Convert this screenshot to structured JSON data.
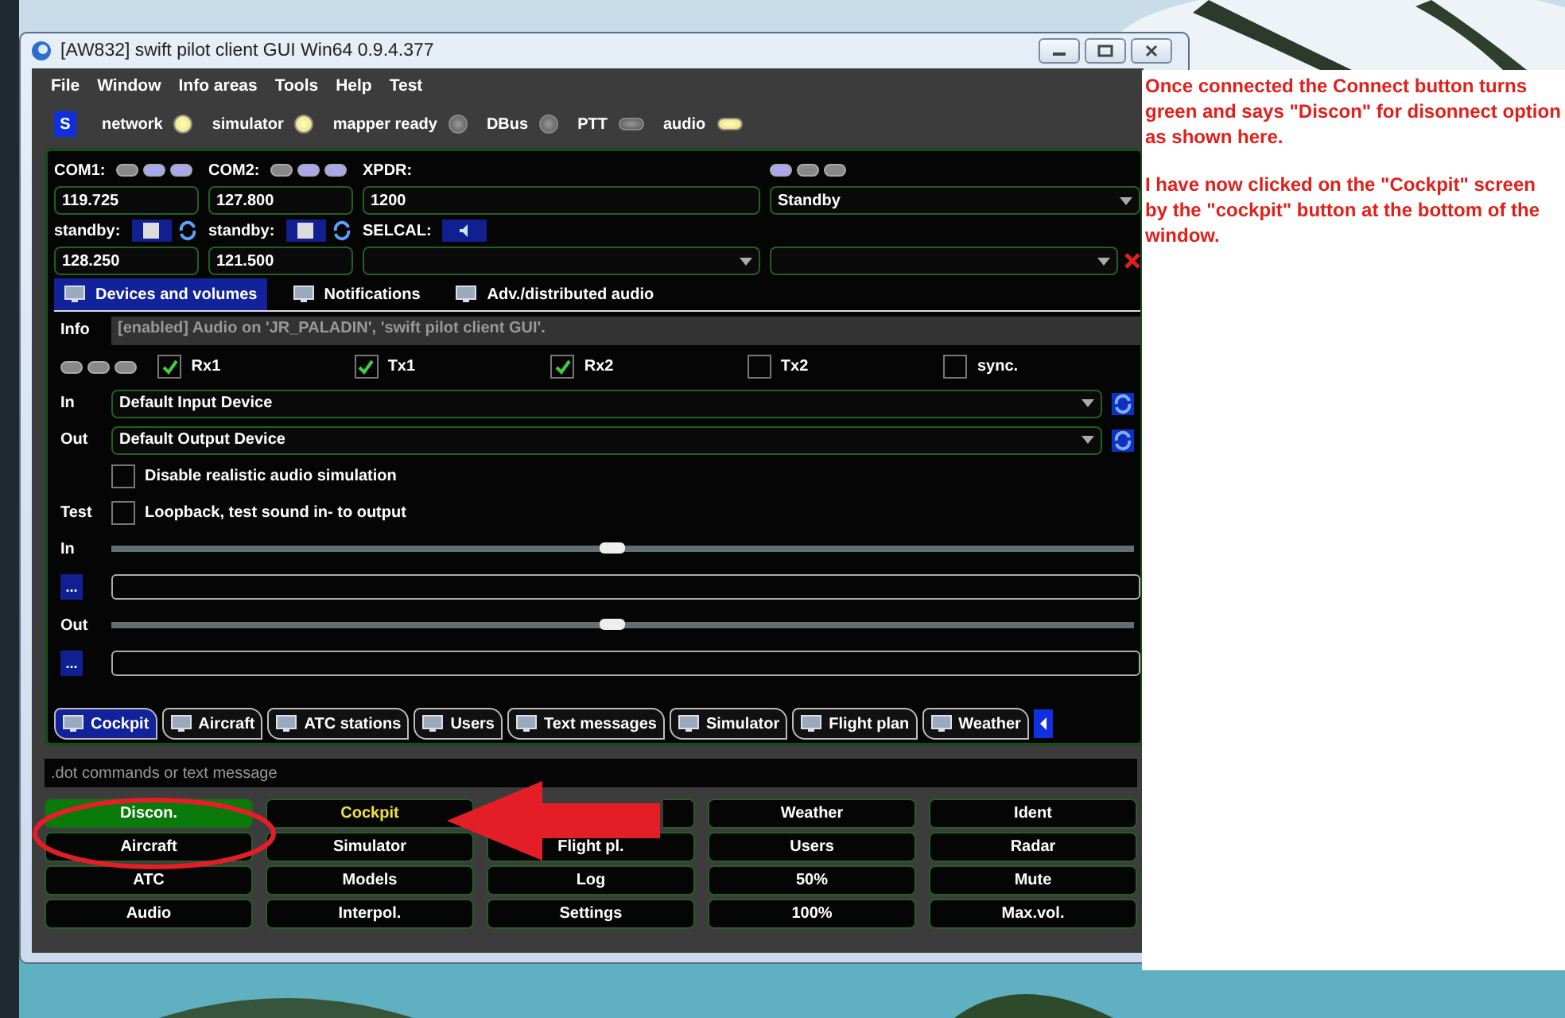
{
  "window": {
    "title": "[AW832] swift pilot client GUI Win64 0.9.4.377"
  },
  "menu": [
    "File",
    "Window",
    "Info areas",
    "Tools",
    "Help",
    "Test"
  ],
  "status": {
    "badge": "S",
    "indicators": [
      {
        "label": "network",
        "kind": "led",
        "on": true
      },
      {
        "label": "simulator",
        "kind": "led",
        "on": true
      },
      {
        "label": "mapper ready",
        "kind": "led",
        "on": false
      },
      {
        "label": "DBus",
        "kind": "led",
        "on": false
      },
      {
        "label": "PTT",
        "kind": "pill",
        "on": false
      },
      {
        "label": "audio",
        "kind": "pill",
        "on": true
      }
    ]
  },
  "radios": [
    {
      "label": "COM1:",
      "lights": [
        {
          "on": false
        },
        {
          "on": true
        },
        {
          "on": true
        }
      ],
      "active": "119.725",
      "standby_label": "standby:",
      "standby": "128.250"
    },
    {
      "label": "COM2:",
      "lights": [
        {
          "on": false
        },
        {
          "on": true
        },
        {
          "on": true
        }
      ],
      "active": "127.800",
      "standby_label": "standby:",
      "standby": "121.500"
    }
  ],
  "transponder": {
    "label": "XPDR:",
    "code": "1200",
    "selcal_label": "SELCAL:",
    "lights": [
      {
        "on": true
      },
      {
        "on": false
      },
      {
        "on": false
      }
    ],
    "mode": "Standby"
  },
  "audio_tabs": [
    {
      "label": "Devices and volumes",
      "selected": true
    },
    {
      "label": "Notifications",
      "selected": false
    },
    {
      "label": "Adv./distributed audio",
      "selected": false
    }
  ],
  "info": {
    "label": "Info",
    "value": "[enabled] Audio on 'JR_PALADIN', 'swift pilot client GUI'."
  },
  "channel_lights": [
    {
      "on": false
    },
    {
      "on": false
    },
    {
      "on": false
    }
  ],
  "channels": [
    {
      "label": "Rx1",
      "checked": true
    },
    {
      "label": "Tx1",
      "checked": true
    },
    {
      "label": "Rx2",
      "checked": true
    },
    {
      "label": "Tx2",
      "checked": false
    },
    {
      "label": "sync.",
      "checked": false
    }
  ],
  "devices": [
    {
      "label": "In",
      "value": "Default Input Device"
    },
    {
      "label": "Out",
      "value": "Default Output Device"
    }
  ],
  "options": [
    {
      "text": "Disable realistic audio simulation",
      "checked": false
    },
    {
      "label": "Test",
      "text": "Loopback, test sound in- to output",
      "checked": false
    }
  ],
  "volumes": [
    {
      "label": "In",
      "level": 0.49,
      "button": "..."
    },
    {
      "label": "Out",
      "level": 0.49,
      "button": "..."
    }
  ],
  "main_tabs": [
    {
      "label": "Cockpit",
      "selected": true
    },
    {
      "label": "Aircraft",
      "selected": false
    },
    {
      "label": "ATC stations",
      "selected": false
    },
    {
      "label": "Users",
      "selected": false
    },
    {
      "label": "Text messages",
      "selected": false
    },
    {
      "label": "Simulator",
      "selected": false
    },
    {
      "label": "Flight plan",
      "selected": false
    },
    {
      "label": "Weather",
      "selected": false
    }
  ],
  "command": {
    "placeholder": ".dot commands or text message"
  },
  "buttons": [
    {
      "label": "Discon.",
      "kind": "connect",
      "selected": false
    },
    {
      "label": "Cockpit",
      "kind": "plain",
      "selected": true
    },
    {
      "kind": "covered"
    },
    {
      "label": "Weather",
      "kind": "plain",
      "selected": false
    },
    {
      "label": "Ident",
      "kind": "plain",
      "selected": false
    },
    {
      "label": "Aircraft",
      "kind": "plain",
      "selected": false
    },
    {
      "label": "Simulator",
      "kind": "plain",
      "selected": false
    },
    {
      "label": "Flight pl.",
      "kind": "plain",
      "selected": false
    },
    {
      "label": "Users",
      "kind": "plain",
      "selected": false
    },
    {
      "label": "Radar",
      "kind": "plain",
      "selected": false
    },
    {
      "label": "ATC",
      "kind": "plain",
      "selected": false
    },
    {
      "label": "Models",
      "kind": "plain",
      "selected": false
    },
    {
      "label": "Log",
      "kind": "plain",
      "selected": false
    },
    {
      "label": "50%",
      "kind": "plain",
      "selected": false
    },
    {
      "label": "Mute",
      "kind": "plain",
      "selected": false
    },
    {
      "label": "Audio",
      "kind": "plain",
      "selected": false
    },
    {
      "label": "Interpol.",
      "kind": "plain",
      "selected": false
    },
    {
      "label": "Settings",
      "kind": "plain",
      "selected": false
    },
    {
      "label": "100%",
      "kind": "plain",
      "selected": false
    },
    {
      "label": "Max.vol.",
      "kind": "plain",
      "selected": false
    }
  ],
  "note": {
    "paragraphs": [
      "Once connected the Connect button turns green and says \"Discon\" for disonnect option as shown here.",
      "I have now clicked on the \"Cockpit\" screen by the \"cockpit\" button at the bottom of the window."
    ]
  }
}
